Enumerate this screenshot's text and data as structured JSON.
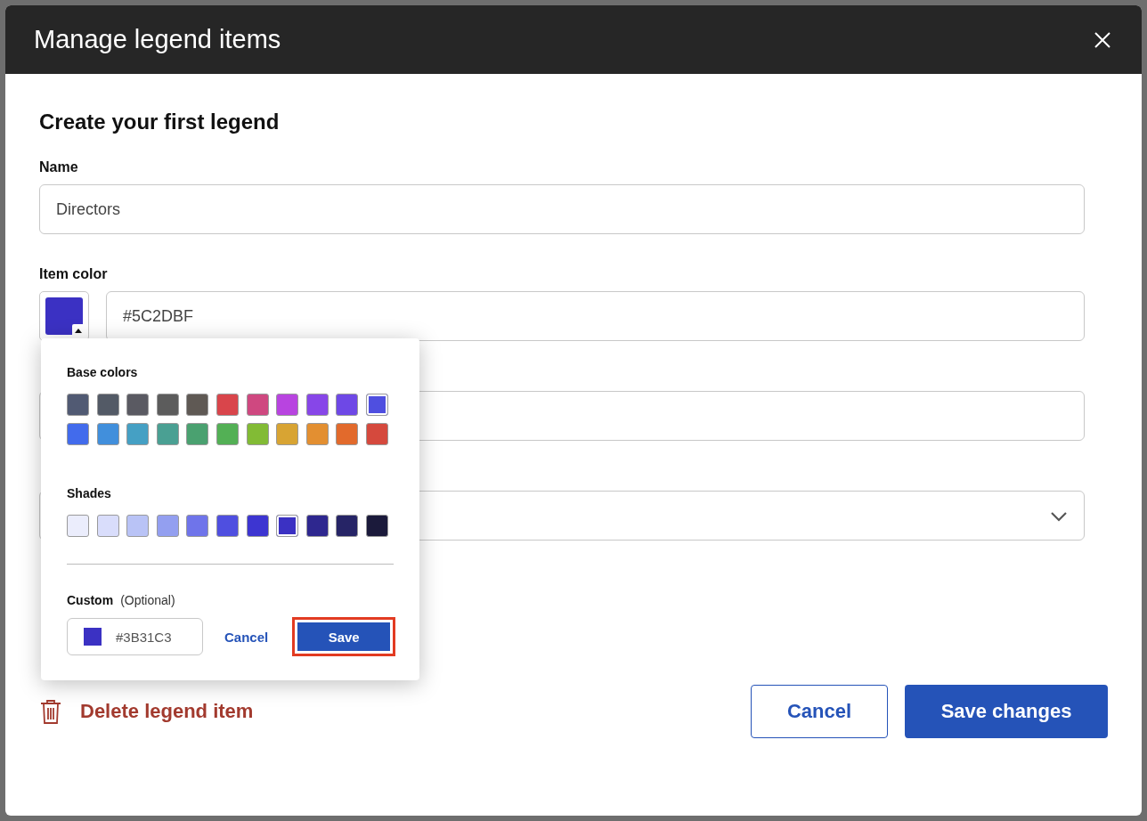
{
  "window": {
    "title": "Manage legend items"
  },
  "form": {
    "heading": "Create your first legend",
    "name": {
      "label": "Name",
      "value": "Directors"
    },
    "item_color": {
      "label": "Item color",
      "swatch": {
        "color": "#3b31c3"
      },
      "value": "#5C2DBF"
    }
  },
  "color_picker": {
    "base_label": "Base colors",
    "base_colors": [
      {
        "color": "#515a73",
        "selected": false
      },
      {
        "color": "#535a66",
        "selected": false
      },
      {
        "color": "#5a5a62",
        "selected": false
      },
      {
        "color": "#5c5c5c",
        "selected": false
      },
      {
        "color": "#5f5954",
        "selected": false
      },
      {
        "color": "#d9454b",
        "selected": false
      },
      {
        "color": "#cf4880",
        "selected": false
      },
      {
        "color": "#b844e0",
        "selected": false
      },
      {
        "color": "#8746e8",
        "selected": false
      },
      {
        "color": "#6e48e6",
        "selected": false
      },
      {
        "color": "#4f4fe0",
        "selected": true
      },
      {
        "color": "#426bec",
        "selected": false
      },
      {
        "color": "#418fdc",
        "selected": false
      },
      {
        "color": "#45a0c4",
        "selected": false
      },
      {
        "color": "#4aa093",
        "selected": false
      },
      {
        "color": "#4aa170",
        "selected": false
      },
      {
        "color": "#53b055",
        "selected": false
      },
      {
        "color": "#82bb35",
        "selected": false
      },
      {
        "color": "#d8a433",
        "selected": false
      },
      {
        "color": "#e38f31",
        "selected": false
      },
      {
        "color": "#e26a2c",
        "selected": false
      },
      {
        "color": "#d5493d",
        "selected": false
      }
    ],
    "shades_label": "Shades",
    "shades": [
      {
        "color": "#ebedfc",
        "selected": false
      },
      {
        "color": "#d9ddfb",
        "selected": false
      },
      {
        "color": "#b9c3f6",
        "selected": false
      },
      {
        "color": "#939ff0",
        "selected": false
      },
      {
        "color": "#6f74ea",
        "selected": false
      },
      {
        "color": "#4f4fe0",
        "selected": false
      },
      {
        "color": "#3d35d1",
        "selected": false
      },
      {
        "color": "#3b31c3",
        "selected": true
      },
      {
        "color": "#2e278f",
        "selected": false
      },
      {
        "color": "#262466",
        "selected": false
      },
      {
        "color": "#1b1a3b",
        "selected": false
      }
    ],
    "custom_label": "Custom",
    "custom_hint": "(Optional)",
    "custom_swatch": {
      "color": "#3b31c3"
    },
    "custom_value": "#3B31C3",
    "cancel": "Cancel",
    "save": {
      "label": "Save",
      "highlighted": true
    }
  },
  "footer": {
    "delete": "Delete legend item",
    "cancel": "Cancel",
    "save": "Save changes"
  }
}
